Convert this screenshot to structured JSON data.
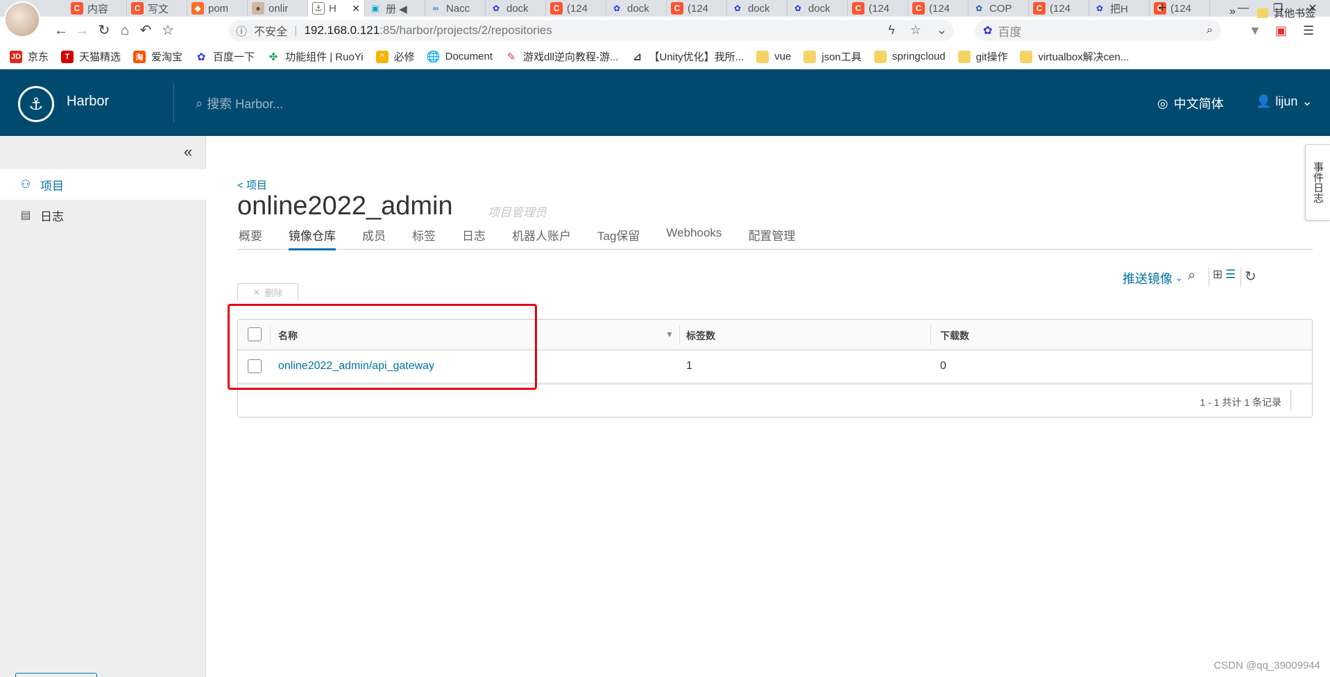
{
  "browser": {
    "tabs": [
      {
        "icon": "csdn",
        "glyph": "C",
        "label": "内容"
      },
      {
        "icon": "csdn",
        "glyph": "C",
        "label": "写文"
      },
      {
        "icon": "gitlab",
        "glyph": "◆",
        "label": "pom"
      },
      {
        "icon": "user",
        "glyph": "●",
        "label": "onlir"
      },
      {
        "icon": "harbor",
        "glyph": "⚓",
        "label": "H",
        "active": true
      },
      {
        "icon": "bili",
        "glyph": "▣",
        "label": "册 ◀"
      },
      {
        "icon": "nacos",
        "glyph": "∞",
        "label": "Nacc"
      },
      {
        "icon": "baidu",
        "glyph": "✿",
        "label": "dock"
      },
      {
        "icon": "csdn",
        "glyph": "C",
        "label": "(124"
      },
      {
        "icon": "baidu",
        "glyph": "✿",
        "label": "dock"
      },
      {
        "icon": "csdn",
        "glyph": "C",
        "label": "(124"
      },
      {
        "icon": "baidu",
        "glyph": "✿",
        "label": "dock"
      },
      {
        "icon": "baidu",
        "glyph": "✿",
        "label": "dock"
      },
      {
        "icon": "csdn",
        "glyph": "C",
        "label": "(124"
      },
      {
        "icon": "csdn",
        "glyph": "C",
        "label": "(124"
      },
      {
        "icon": "cop",
        "glyph": "✿",
        "label": "COP"
      },
      {
        "icon": "csdn",
        "glyph": "C",
        "label": "(124"
      },
      {
        "icon": "baidu",
        "glyph": "✿",
        "label": "把H"
      },
      {
        "icon": "csdn",
        "glyph": "C",
        "label": "(124"
      }
    ],
    "new_tab": "+",
    "address": {
      "info_glyph": "ⓘ",
      "insecure": "不安全",
      "separator": "|",
      "host": "192.168.0.121",
      "path": ":85/harbor/projects/2/repositories"
    },
    "search": {
      "placeholder": "百度"
    },
    "bookmarks": [
      {
        "icon": "jd",
        "glyph": "JD",
        "label": "京东"
      },
      {
        "icon": "tmall",
        "glyph": "T",
        "label": "天猫精选"
      },
      {
        "icon": "taobao",
        "glyph": "淘",
        "label": "爱淘宝"
      },
      {
        "icon": "baidu",
        "glyph": "✿",
        "label": "百度一下"
      },
      {
        "icon": "ruoyi",
        "glyph": "✤",
        "label": "功能组件 | RuoYi"
      },
      {
        "icon": "bixiu",
        "glyph": "^",
        "label": "必修"
      },
      {
        "icon": "globe",
        "glyph": "🌐",
        "label": "Document"
      },
      {
        "icon": "game",
        "glyph": "✎",
        "label": "游戏dll逆向教程-游..."
      },
      {
        "icon": "unity",
        "glyph": "⊿",
        "label": "【Unity优化】我所..."
      },
      {
        "icon": "folder",
        "glyph": "",
        "label": "vue"
      },
      {
        "icon": "folder",
        "glyph": "",
        "label": "json工具"
      },
      {
        "icon": "folder",
        "glyph": "",
        "label": "springcloud"
      },
      {
        "icon": "folder",
        "glyph": "",
        "label": "git操作"
      },
      {
        "icon": "folder",
        "glyph": "",
        "label": "virtualbox解决cen..."
      }
    ],
    "more": "»",
    "other_bookmarks": "其他书签"
  },
  "harbor": {
    "brand": "Harbor",
    "search_placeholder": "搜索 Harbor...",
    "language": "中文简体",
    "user": "lijun",
    "sidenav": [
      {
        "label": "项目",
        "active": true
      },
      {
        "label": "日志",
        "active": false
      }
    ],
    "breadcrumb": "< 项目",
    "project_name": "online2022_admin",
    "project_role": "项目管理员",
    "tabs": [
      "概要",
      "镜像仓库",
      "成员",
      "标签",
      "日志",
      "机器人账户",
      "Tag保留",
      "Webhooks",
      "配置管理"
    ],
    "active_tab": "镜像仓库",
    "push_image": "推送镜像",
    "delete": "删除",
    "columns": [
      "名称",
      "标签数",
      "下载数"
    ],
    "rows": [
      {
        "name": "online2022_admin/api_gateway",
        "tags": "1",
        "pulls": "0"
      }
    ],
    "pagination": "1 - 1 共计 1 条记录",
    "event_tab": "事件日志"
  },
  "watermark": "CSDN @qq_39009944",
  "colors": {
    "header": "#004a70",
    "link": "#0072a3",
    "highlight": "#e8000b"
  }
}
